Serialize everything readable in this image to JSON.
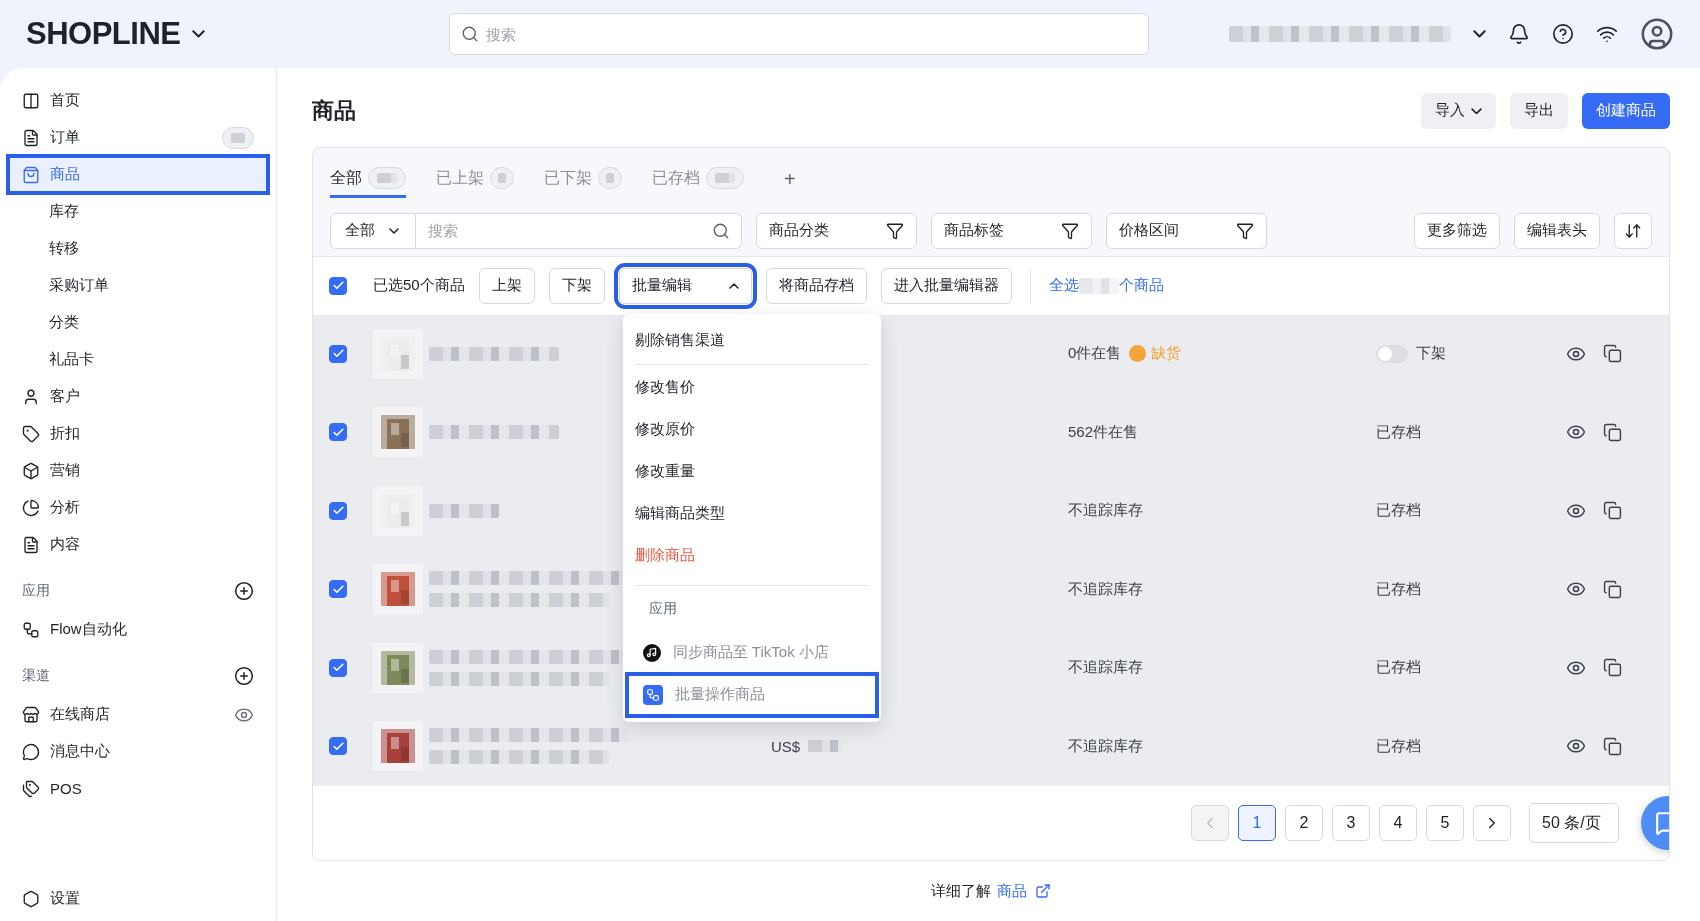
{
  "topbar": {
    "logo": "SHOPLINE",
    "search": {
      "placeholder": "搜索"
    }
  },
  "sidebar": {
    "items": [
      {
        "label": "首页",
        "selected": false
      },
      {
        "label": "订单",
        "selected": false,
        "badge": true
      },
      {
        "label": "商品",
        "selected": true,
        "highlighted": true,
        "children": [
          {
            "label": "库存",
            "selected": false
          },
          {
            "label": "转移",
            "selected": false
          },
          {
            "label": "采购订单",
            "selected": false
          },
          {
            "label": "分类",
            "selected": false
          },
          {
            "label": "礼品卡",
            "selected": false
          }
        ]
      },
      {
        "label": "客户",
        "selected": false
      },
      {
        "label": "折扣",
        "selected": false
      },
      {
        "label": "营销",
        "selected": false
      },
      {
        "label": "分析",
        "selected": false
      },
      {
        "label": "内容",
        "selected": false
      }
    ],
    "sections": [
      {
        "title": "应用",
        "items": [
          {
            "label": "Flow自动化",
            "selected": false
          }
        ]
      },
      {
        "title": "渠道",
        "items": [
          {
            "label": "在线商店",
            "selected": false,
            "preview": true
          },
          {
            "label": "消息中心",
            "selected": false
          },
          {
            "label": "POS",
            "selected": false
          }
        ]
      }
    ],
    "footer_item": {
      "label": "设置",
      "selected": false
    }
  },
  "page": {
    "title": "商品",
    "actions": [
      {
        "label": "导入",
        "kind": "dropdown"
      },
      {
        "label": "导出",
        "kind": "default"
      },
      {
        "label": "创建商品",
        "kind": "primary"
      }
    ]
  },
  "tabs": [
    {
      "label": "全部",
      "selected": true
    },
    {
      "label": "已上架",
      "selected": false
    },
    {
      "label": "已下架",
      "selected": false
    },
    {
      "label": "已存档",
      "selected": false
    }
  ],
  "add_tab": "+",
  "filters": {
    "scope": "全部",
    "search_placeholder": "搜索",
    "facets": [
      "商品分类",
      "商品标签",
      "价格区间"
    ],
    "buttons": [
      "更多筛选",
      "编辑表头"
    ]
  },
  "bulk": {
    "checked": true,
    "summary": "已选50个商品",
    "actions": [
      {
        "label": "上架",
        "kind": "button"
      },
      {
        "label": "下架",
        "kind": "button"
      },
      {
        "label": "批量编辑",
        "kind": "menu",
        "expanded": true,
        "highlighted": true
      },
      {
        "label": "将商品存档",
        "kind": "button"
      },
      {
        "label": "进入批量编辑器",
        "kind": "button"
      }
    ],
    "select_all": {
      "before": "全选",
      "after": "个商品"
    }
  },
  "menu": {
    "items": [
      {
        "label": "剔除销售渠道",
        "kind": "normal"
      },
      {
        "label": "修改售价",
        "kind": "normal"
      },
      {
        "label": "修改原价",
        "kind": "normal"
      },
      {
        "label": "修改重量",
        "kind": "normal"
      },
      {
        "label": "编辑商品类型",
        "kind": "normal"
      },
      {
        "label": "删除商品",
        "kind": "danger"
      }
    ],
    "section": {
      "title": "应用",
      "items": [
        {
          "label": "同步商品至 TikTok 小店",
          "highlighted": false
        },
        {
          "label": "批量操作商品",
          "highlighted": true
        }
      ]
    }
  },
  "rows": [
    {
      "checked": true,
      "color": "#ececee",
      "stock": "0件在售",
      "warning": "缺货",
      "status": {
        "kind": "toggle",
        "on": false,
        "label": "下架"
      }
    },
    {
      "checked": true,
      "color": "#8a7258",
      "stock": "562件在售",
      "status": {
        "kind": "text",
        "label": "已存档"
      }
    },
    {
      "checked": true,
      "color": "#ececee",
      "stock": "不追踪库存",
      "status": {
        "kind": "text",
        "label": "已存档"
      }
    },
    {
      "checked": true,
      "color": "#c0503c",
      "stock": "不追踪库存",
      "status": {
        "kind": "text",
        "label": "已存档"
      }
    },
    {
      "checked": true,
      "color": "#7d8a5a",
      "stock": "不追踪库存",
      "status": {
        "kind": "text",
        "label": "已存档"
      }
    },
    {
      "checked": true,
      "color": "#a8403c",
      "price": "US$",
      "stock": "不追踪库存",
      "status": {
        "kind": "text",
        "label": "已存档"
      }
    }
  ],
  "pagination": {
    "prev_disabled": true,
    "pages": [
      {
        "label": "1",
        "selected": true
      },
      {
        "label": "2",
        "selected": false
      },
      {
        "label": "3",
        "selected": false
      },
      {
        "label": "4",
        "selected": false
      },
      {
        "label": "5",
        "selected": false
      }
    ],
    "page_size": "50 条/页"
  },
  "footer": {
    "text": "详细了解",
    "link": "商品"
  }
}
